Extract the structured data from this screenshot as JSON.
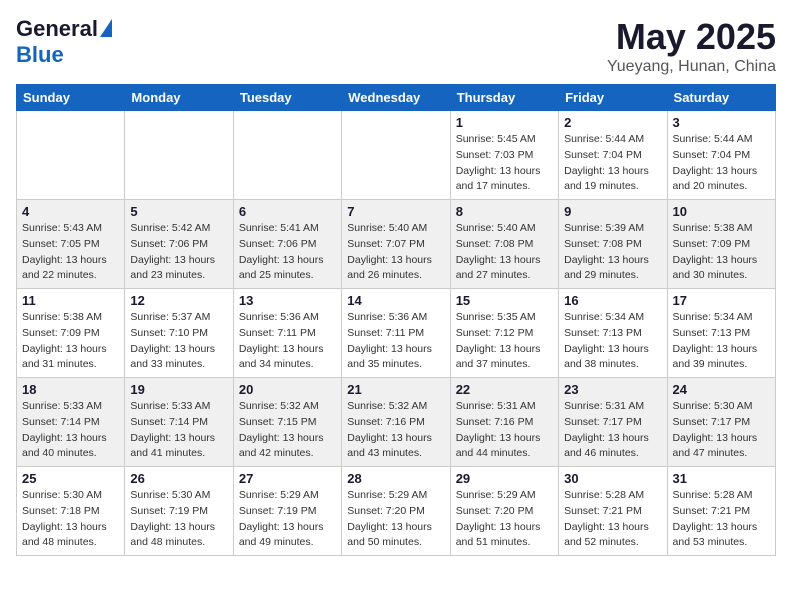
{
  "header": {
    "logo_general": "General",
    "logo_blue": "Blue",
    "title_month": "May 2025",
    "title_location": "Yueyang, Hunan, China"
  },
  "weekdays": [
    "Sunday",
    "Monday",
    "Tuesday",
    "Wednesday",
    "Thursday",
    "Friday",
    "Saturday"
  ],
  "weeks": [
    [
      {
        "day": "",
        "info": ""
      },
      {
        "day": "",
        "info": ""
      },
      {
        "day": "",
        "info": ""
      },
      {
        "day": "",
        "info": ""
      },
      {
        "day": "1",
        "info": "Sunrise: 5:45 AM\nSunset: 7:03 PM\nDaylight: 13 hours\nand 17 minutes."
      },
      {
        "day": "2",
        "info": "Sunrise: 5:44 AM\nSunset: 7:04 PM\nDaylight: 13 hours\nand 19 minutes."
      },
      {
        "day": "3",
        "info": "Sunrise: 5:44 AM\nSunset: 7:04 PM\nDaylight: 13 hours\nand 20 minutes."
      }
    ],
    [
      {
        "day": "4",
        "info": "Sunrise: 5:43 AM\nSunset: 7:05 PM\nDaylight: 13 hours\nand 22 minutes."
      },
      {
        "day": "5",
        "info": "Sunrise: 5:42 AM\nSunset: 7:06 PM\nDaylight: 13 hours\nand 23 minutes."
      },
      {
        "day": "6",
        "info": "Sunrise: 5:41 AM\nSunset: 7:06 PM\nDaylight: 13 hours\nand 25 minutes."
      },
      {
        "day": "7",
        "info": "Sunrise: 5:40 AM\nSunset: 7:07 PM\nDaylight: 13 hours\nand 26 minutes."
      },
      {
        "day": "8",
        "info": "Sunrise: 5:40 AM\nSunset: 7:08 PM\nDaylight: 13 hours\nand 27 minutes."
      },
      {
        "day": "9",
        "info": "Sunrise: 5:39 AM\nSunset: 7:08 PM\nDaylight: 13 hours\nand 29 minutes."
      },
      {
        "day": "10",
        "info": "Sunrise: 5:38 AM\nSunset: 7:09 PM\nDaylight: 13 hours\nand 30 minutes."
      }
    ],
    [
      {
        "day": "11",
        "info": "Sunrise: 5:38 AM\nSunset: 7:09 PM\nDaylight: 13 hours\nand 31 minutes."
      },
      {
        "day": "12",
        "info": "Sunrise: 5:37 AM\nSunset: 7:10 PM\nDaylight: 13 hours\nand 33 minutes."
      },
      {
        "day": "13",
        "info": "Sunrise: 5:36 AM\nSunset: 7:11 PM\nDaylight: 13 hours\nand 34 minutes."
      },
      {
        "day": "14",
        "info": "Sunrise: 5:36 AM\nSunset: 7:11 PM\nDaylight: 13 hours\nand 35 minutes."
      },
      {
        "day": "15",
        "info": "Sunrise: 5:35 AM\nSunset: 7:12 PM\nDaylight: 13 hours\nand 37 minutes."
      },
      {
        "day": "16",
        "info": "Sunrise: 5:34 AM\nSunset: 7:13 PM\nDaylight: 13 hours\nand 38 minutes."
      },
      {
        "day": "17",
        "info": "Sunrise: 5:34 AM\nSunset: 7:13 PM\nDaylight: 13 hours\nand 39 minutes."
      }
    ],
    [
      {
        "day": "18",
        "info": "Sunrise: 5:33 AM\nSunset: 7:14 PM\nDaylight: 13 hours\nand 40 minutes."
      },
      {
        "day": "19",
        "info": "Sunrise: 5:33 AM\nSunset: 7:14 PM\nDaylight: 13 hours\nand 41 minutes."
      },
      {
        "day": "20",
        "info": "Sunrise: 5:32 AM\nSunset: 7:15 PM\nDaylight: 13 hours\nand 42 minutes."
      },
      {
        "day": "21",
        "info": "Sunrise: 5:32 AM\nSunset: 7:16 PM\nDaylight: 13 hours\nand 43 minutes."
      },
      {
        "day": "22",
        "info": "Sunrise: 5:31 AM\nSunset: 7:16 PM\nDaylight: 13 hours\nand 44 minutes."
      },
      {
        "day": "23",
        "info": "Sunrise: 5:31 AM\nSunset: 7:17 PM\nDaylight: 13 hours\nand 46 minutes."
      },
      {
        "day": "24",
        "info": "Sunrise: 5:30 AM\nSunset: 7:17 PM\nDaylight: 13 hours\nand 47 minutes."
      }
    ],
    [
      {
        "day": "25",
        "info": "Sunrise: 5:30 AM\nSunset: 7:18 PM\nDaylight: 13 hours\nand 48 minutes."
      },
      {
        "day": "26",
        "info": "Sunrise: 5:30 AM\nSunset: 7:19 PM\nDaylight: 13 hours\nand 48 minutes."
      },
      {
        "day": "27",
        "info": "Sunrise: 5:29 AM\nSunset: 7:19 PM\nDaylight: 13 hours\nand 49 minutes."
      },
      {
        "day": "28",
        "info": "Sunrise: 5:29 AM\nSunset: 7:20 PM\nDaylight: 13 hours\nand 50 minutes."
      },
      {
        "day": "29",
        "info": "Sunrise: 5:29 AM\nSunset: 7:20 PM\nDaylight: 13 hours\nand 51 minutes."
      },
      {
        "day": "30",
        "info": "Sunrise: 5:28 AM\nSunset: 7:21 PM\nDaylight: 13 hours\nand 52 minutes."
      },
      {
        "day": "31",
        "info": "Sunrise: 5:28 AM\nSunset: 7:21 PM\nDaylight: 13 hours\nand 53 minutes."
      }
    ]
  ]
}
